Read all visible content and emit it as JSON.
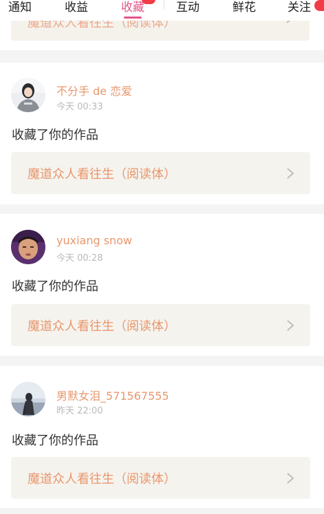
{
  "tabs": [
    {
      "label": "通知"
    },
    {
      "label": "收益"
    },
    {
      "label": "收藏",
      "active": true
    },
    {
      "label": "互动"
    },
    {
      "label": "鲜花"
    },
    {
      "label": "关注"
    }
  ],
  "colors": {
    "accent": "#e2568a",
    "name": "#e8976d",
    "badge": "#f23b45",
    "card_bg": "#f5f3ee"
  },
  "partial_item": {
    "work_title": "魔道众人看往生（阅读体）"
  },
  "notifications": [
    {
      "user": "不分手 de 恋爱",
      "time": "今天 00:33",
      "action": "收藏了你的作品",
      "work_title": "魔道众人看往生（阅读体）",
      "avatar_icon": "user-avatar-girl"
    },
    {
      "user": "yuxiang snow",
      "time": "今天 00:28",
      "action": "收藏了你的作品",
      "work_title": "魔道众人看往生（阅读体）",
      "avatar_icon": "user-avatar-boy"
    },
    {
      "user": "男默女泪_571567555",
      "time": "昨天 22:00",
      "action": "收藏了你的作品",
      "work_title": "魔道众人看往生（阅读体）",
      "avatar_icon": "user-avatar-silhouette"
    }
  ]
}
